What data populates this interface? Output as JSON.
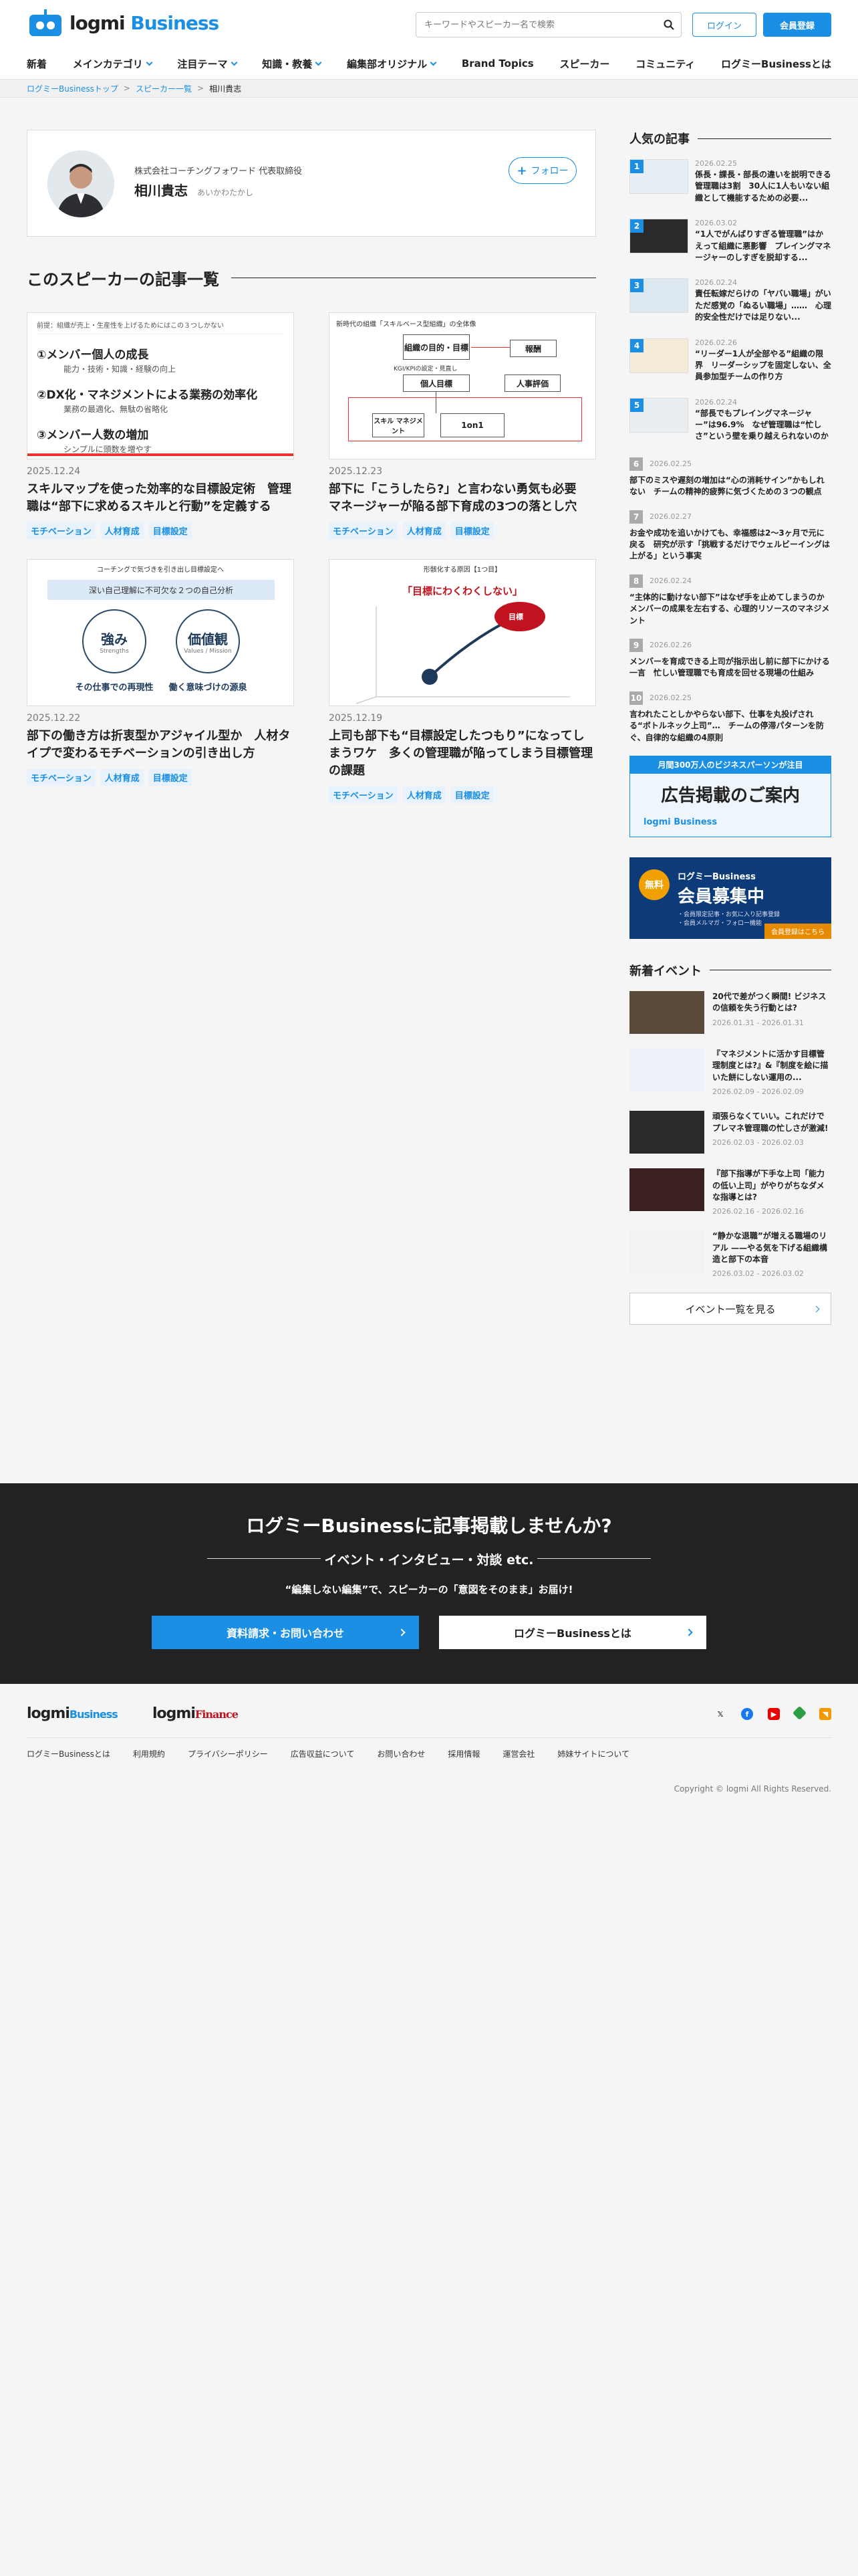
{
  "header": {
    "logo_main": "logmi",
    "logo_sub": "Business",
    "search_placeholder": "キーワードやスピーカー名で検索",
    "login": "ログイン",
    "register": "会員登録"
  },
  "nav": [
    {
      "label": "新着",
      "chev": false
    },
    {
      "label": "メインカテゴリ",
      "chev": true
    },
    {
      "label": "注目テーマ",
      "chev": true
    },
    {
      "label": "知識・教養",
      "chev": true
    },
    {
      "label": "編集部オリジナル",
      "chev": true
    },
    {
      "label": "Brand Topics",
      "chev": false
    },
    {
      "label": "スピーカー",
      "chev": false
    },
    {
      "label": "コミュニティ",
      "chev": false
    },
    {
      "label": "ログミーBusinessとは",
      "chev": false
    }
  ],
  "breadcrumb": [
    "ログミーBusinessトップ",
    "スピーカー一覧",
    "相川貴志"
  ],
  "speaker": {
    "org": "株式会社コーチングフォワード 代表取締役",
    "name": "相川貴志",
    "ruby": "あいかわたかし",
    "follow": "フォロー"
  },
  "section_title": "このスピーカーの記事一覧",
  "articles": [
    {
      "date": "2025.12.24",
      "title": "スキルマップを使った効率的な目標設定術　管理職は“部下に求めるスキルと行動”を定義する",
      "tags": [
        "モチベーション",
        "人材育成",
        "目標設定"
      ],
      "thumb": {
        "header": "前提：組織が売上・生産性を上げるためにはこの３つしかない",
        "items": [
          {
            "head": "①メンバー個人の成長",
            "sub": "能力・技術・知識・経験の向上"
          },
          {
            "head": "②DX化・マネジメントによる業務の効率化",
            "sub": "業務の最適化、無駄の省略化"
          },
          {
            "head": "③メンバー人数の増加",
            "sub": "シンプルに頭数を増やす"
          }
        ]
      }
    },
    {
      "date": "2025.12.23",
      "title": "部下に「こうしたら?」と言わない勇気も必要　マネージャーが陥る部下育成の3つの落とし穴",
      "tags": [
        "モチベーション",
        "人材育成",
        "目標設定"
      ],
      "thumb": {
        "header": "新時代の組織「スキルベース型組織」の全体像",
        "boxes": [
          "組織の目的・目標",
          "報酬",
          "個人目標",
          "人事評価",
          "スキル マネジメント",
          "1on1"
        ],
        "sub": "KGI/KPIの設定・見直し"
      }
    },
    {
      "date": "2025.12.22",
      "title": "部下の働き方は折衷型かアジャイル型か　人材タイプで変わるモチベーションの引き出し方",
      "tags": [
        "モチベーション",
        "人材育成",
        "目標設定"
      ],
      "thumb": {
        "header": "コーチングで気づきを引き出し目標設定へ",
        "band": "深い自己理解に不可欠な２つの自己分析",
        "c1": "強み",
        "c1en": "Strengths",
        "c2": "価値観",
        "c2en": "Values / Mission",
        "cap1": "その仕事での再現性",
        "cap2": "働く意味づけの源泉"
      }
    },
    {
      "date": "2025.12.19",
      "title": "上司も部下も“目標設定したつもり”になってしまうワケ　多くの管理職が陥ってしまう目標管理の課題",
      "tags": [
        "モチベーション",
        "人材育成",
        "目標設定"
      ],
      "thumb": {
        "header": "形骸化する原因【1つ目】",
        "red": "「目標にわくわくしない」",
        "goal": "目標"
      }
    }
  ],
  "sidebar": {
    "popular_title": "人気の記事",
    "popular": [
      {
        "n": "1",
        "date": "2026.02.25",
        "title": "係長・課長・部長の違いを説明できる管理職は3割　30人に1人もいない組織として機能するための必要..."
      },
      {
        "n": "2",
        "date": "2026.03.02",
        "title": "“1人でがんばりすぎる管理職”はかえって組織に悪影響　プレイングマネージャーのしすぎを脱却する..."
      },
      {
        "n": "3",
        "date": "2026.02.24",
        "title": "責任転嫁だらけの「ヤバい職場」がいただ感覚の「ぬるい職場」……　心理的安全性だけでは足りない..."
      },
      {
        "n": "4",
        "date": "2026.02.26",
        "title": "“リーダー1人が全部やる”組織の限界　リーダーシップを固定しない、全員参加型チームの作り方"
      },
      {
        "n": "5",
        "date": "2026.02.24",
        "title": "“部長でもプレイングマネージャー”は96.9%　なぜ管理職は“忙しさ”という壁を乗り越えられないのか"
      },
      {
        "n": "6",
        "date": "2026.02.25",
        "title": "部下のミスや遅刻の増加は“心の消耗サイン”かもしれない　チームの精神的疲弊に気づくための３つの観点"
      },
      {
        "n": "7",
        "date": "2026.02.27",
        "title": "お金や成功を追いかけても、幸福感は2〜3ヶ月で元に戻る　研究が示す「挑戦するだけでウェルビーイングは上がる」という事実"
      },
      {
        "n": "8",
        "date": "2026.02.24",
        "title": "“主体的に動けない部下”はなぜ手を止めてしまうのか　メンバーの成果を左右する、心理的リソースのマネジメント"
      },
      {
        "n": "9",
        "date": "2026.02.26",
        "title": "メンバーを育成できる上司が指示出し前に部下にかける一言　忙しい管理職でも育成を回せる現場の仕組み"
      },
      {
        "n": "10",
        "date": "2026.02.25",
        "title": "言われたことしかやらない部下、仕事を丸投げされる“ボトルネック上司”…　チームの停滞パターンを防ぐ、自律的な組織の4原則"
      }
    ],
    "banner1": {
      "top": "月間300万人のビジネスパーソンが注目",
      "main": "広告掲載のご案内",
      "logo": "logmi Business"
    },
    "banner2": {
      "badge": "無料",
      "top": "ログミーBusiness",
      "main": "会員募集中",
      "lines": [
        "・会員限定記事・お気に入り記事登録",
        "・会員メルマガ・フォロー機能"
      ],
      "cta": "会員登録はこちら"
    },
    "events_title": "新着イベント",
    "events": [
      {
        "title": "20代で差がつく瞬間! ビジネスの信頼を失う行動とは?",
        "date": "2026.01.31 - 2026.01.31"
      },
      {
        "title": "『マネジメントに活かす目標管理制度とは?』&『制度を絵に描いた餅にしない運用の...",
        "date": "2026.02.09 - 2026.02.09"
      },
      {
        "title": "頑張らなくていい。これだけでプレマネ管理職の忙しさが激減!",
        "date": "2026.02.03 - 2026.02.03"
      },
      {
        "title": "『部下指導が下手な上司「能力の低い上司」がやりがちなダメな指導とは?",
        "date": "2026.02.16 - 2026.02.16"
      },
      {
        "title": "“静かな退職”が増える職場のリアル ——やる気を下げる組織構造と部下の本音",
        "date": "2026.03.02 - 2026.03.02"
      }
    ],
    "events_button": "イベント一覧を見る"
  },
  "cta": {
    "title": "ログミーBusinessに記事掲載しませんか?",
    "sub1": "イベント・インタビュー・対談 etc.",
    "sub2": "“編集しない編集”で、スピーカーの「意図をそのまま」お届け!",
    "btn1": "資料請求・お問い合わせ",
    "btn2": "ログミーBusinessとは"
  },
  "footer": {
    "logo1_main": "logmi",
    "logo1_sub": "Business",
    "logo2_main": "logmi",
    "logo2_sub": "Finance",
    "links": [
      "ログミーBusinessとは",
      "利用規約",
      "プライバシーポリシー",
      "広告収益について",
      "お問い合わせ",
      "採用情報",
      "運営会社",
      "姉妹サイトについて"
    ],
    "copyright": "Copyright © logmi All Rights Reserved."
  },
  "colors": {
    "brand": "#1a8fe3",
    "dark": "#222222"
  }
}
